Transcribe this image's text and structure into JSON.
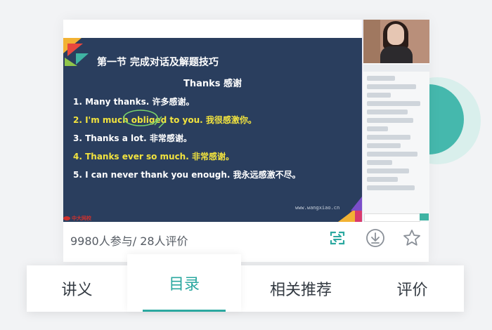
{
  "colors": {
    "accent": "#2ba8a0",
    "slide_bg": "#2a3e5e",
    "highlight_text": "#f2e33e"
  },
  "slide": {
    "title": "第一节 完成对话及解题技巧",
    "subtitle": "Thanks 感谢",
    "lines": [
      {
        "text": "1. Many thanks. 许多感谢。",
        "highlight": false
      },
      {
        "text": "2. I'm much obliged to you. 我很感激你。",
        "highlight": true
      },
      {
        "text": "3. Thanks a lot. 非常感谢。",
        "highlight": false
      },
      {
        "text": "4. Thanks ever so much. 非常感谢。",
        "highlight": true
      },
      {
        "text": "5. I can never thank you enough. 我永远感激不尽。",
        "highlight": false
      }
    ],
    "watermark": "www.wangxiao.cn"
  },
  "logo": {
    "text": "中大网校"
  },
  "stats": {
    "text": "9980人参与/ 28人评价"
  },
  "actions": {
    "share_icon": "share-swap-icon",
    "download_icon": "download-icon",
    "favorite_icon": "star-icon"
  },
  "tabs": [
    {
      "label": "讲义",
      "active": false
    },
    {
      "label": "目录",
      "active": true
    },
    {
      "label": "相关推荐",
      "active": false
    },
    {
      "label": "评价",
      "active": false
    }
  ]
}
